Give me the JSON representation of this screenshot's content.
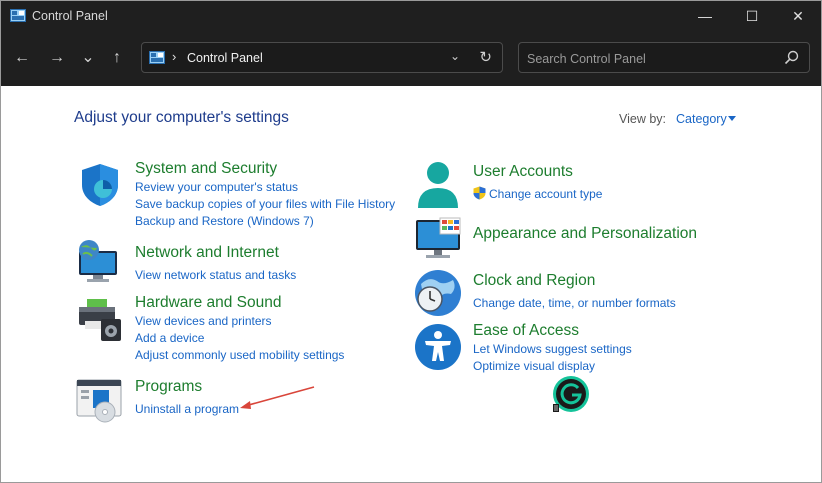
{
  "window": {
    "title": "Control Panel",
    "controls": {
      "minimize": "—",
      "maximize": "☐",
      "close": "✕"
    }
  },
  "nav": {
    "back": "←",
    "forward": "→",
    "recent": "⌄",
    "up": "↑"
  },
  "address": {
    "separator": "›",
    "path": "Control Panel",
    "dropdown": "⌄",
    "refresh": "↻"
  },
  "search": {
    "placeholder": "Search Control Panel",
    "value": ""
  },
  "main": {
    "heading": "Adjust your computer's settings",
    "view_by_label": "View by:",
    "view_by_value": "Category"
  },
  "categories": [
    {
      "title": "System and Security",
      "icon": "shield-icon",
      "links": [
        "Review your computer's status",
        "Save backup copies of your files with File History",
        "Backup and Restore (Windows 7)"
      ]
    },
    {
      "title": "Network and Internet",
      "icon": "network-icon",
      "links": [
        "View network status and tasks"
      ]
    },
    {
      "title": "Hardware and Sound",
      "icon": "printer-icon",
      "links": [
        "View devices and printers",
        "Add a device",
        "Adjust commonly used mobility settings"
      ]
    },
    {
      "title": "Programs",
      "icon": "programs-icon",
      "links": [
        "Uninstall a program"
      ]
    },
    {
      "title": "User Accounts",
      "icon": "user-icon",
      "links": [
        "Change account type"
      ]
    },
    {
      "title": "Appearance and Personalization",
      "icon": "monitor-icon",
      "links": []
    },
    {
      "title": "Clock and Region",
      "icon": "clock-globe-icon",
      "links": [
        "Change date, time, or number formats"
      ]
    },
    {
      "title": "Ease of Access",
      "icon": "accessibility-icon",
      "links": [
        "Let Windows suggest settings",
        "Optimize visual display"
      ]
    }
  ],
  "colors": {
    "titlebar": "#1f1f1f",
    "heading": "#1e3c8c",
    "category_title": "#1d7d2e",
    "link": "#1a66c6",
    "annotation_arrow": "#d9453a"
  }
}
